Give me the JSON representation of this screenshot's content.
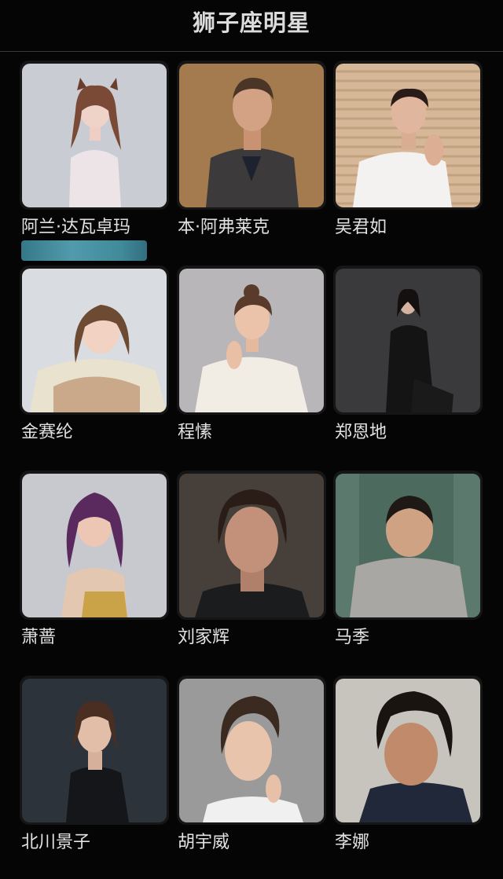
{
  "header": {
    "title": "狮子座明星"
  },
  "celebrities": [
    {
      "name": "阿兰·达瓦卓玛"
    },
    {
      "name": "本·阿弗莱克"
    },
    {
      "name": "吴君如"
    },
    {
      "name": "金赛纶"
    },
    {
      "name": "程愫"
    },
    {
      "name": "郑恩地"
    },
    {
      "name": "萧蔷"
    },
    {
      "name": "刘家辉"
    },
    {
      "name": "马季"
    },
    {
      "name": "北川景子"
    },
    {
      "name": "胡宇威"
    },
    {
      "name": "李娜"
    }
  ]
}
